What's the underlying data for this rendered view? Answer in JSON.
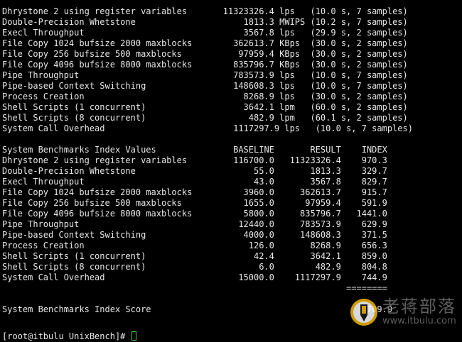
{
  "terminal": {
    "results": [
      "Dhrystone 2 using register variables       11323326.4 lps   (10.0 s, 7 samples)",
      "Double-Precision Whetstone                     1813.3 MWIPS (10.2 s, 7 samples)",
      "Execl Throughput                               3567.8 lps   (29.9 s, 2 samples)",
      "File Copy 1024 bufsize 2000 maxblocks        362613.7 KBps  (30.0 s, 2 samples)",
      "File Copy 256 bufsize 500 maxblocks           97959.4 KBps  (30.0 s, 2 samples)",
      "File Copy 4096 bufsize 8000 maxblocks        835796.7 KBps  (30.0 s, 2 samples)",
      "Pipe Throughput                              783573.9 lps   (10.0 s, 7 samples)",
      "Pipe-based Context Switching                 148608.3 lps   (10.0 s, 7 samples)",
      "Process Creation                               8268.9 lps   (30.0 s, 2 samples)",
      "Shell Scripts (1 concurrent)                   3642.1 lpm   (60.0 s, 2 samples)",
      "Shell Scripts (8 concurrent)                    482.9 lpm   (60.1 s, 2 samples)",
      "System Call Overhead                         1117297.9 lps   (10.0 s, 7 samples)"
    ],
    "index_header": "System Benchmarks Index Values               BASELINE       RESULT    INDEX",
    "index_rows": [
      "Dhrystone 2 using register variables         116700.0   11323326.4    970.3",
      "Double-Precision Whetstone                       55.0       1813.3    329.7",
      "Execl Throughput                                 43.0       3567.8    829.7",
      "File Copy 1024 bufsize 2000 maxblocks          3960.0     362613.7    915.7",
      "File Copy 256 bufsize 500 maxblocks            1655.0      97959.4    591.9",
      "File Copy 4096 bufsize 8000 maxblocks          5800.0     835796.7   1441.0",
      "Pipe Throughput                               12440.0     783573.9    629.9",
      "Pipe-based Context Switching                   4000.0     148608.3    371.5",
      "Process Creation                                126.0       8268.9    656.3",
      "Shell Scripts (1 concurrent)                     42.4       3642.1    859.0",
      "Shell Scripts (8 concurrent)                      6.0        482.9    804.8",
      "System Call Overhead                          15000.0    1117297.9    744.9"
    ],
    "separator": "                                                                   ========",
    "score_line": "System Benchmarks Index Score                                          709.9",
    "prompt": "[root@itbulu UnixBench]# "
  },
  "watermark": {
    "title": "老蒋部落",
    "url": "www.itbulu.com"
  },
  "colors": {
    "background": "#000000",
    "text": "#e8e8e8",
    "cursor": "#3cd33c",
    "watermark": "#6e6e6e"
  }
}
